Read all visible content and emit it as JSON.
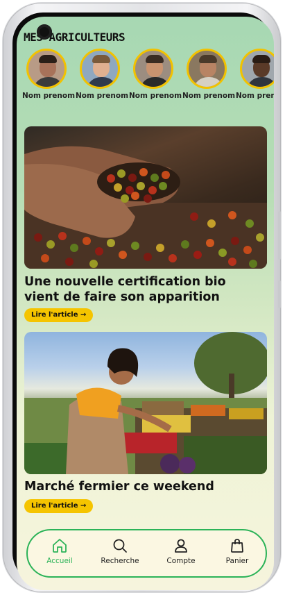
{
  "header": {
    "section_title": "MES AGRICULTEURS"
  },
  "farmers": [
    {
      "name": "Nom prenom"
    },
    {
      "name": "Nom prenom"
    },
    {
      "name": "Nom prenom"
    },
    {
      "name": "Nom prenom"
    },
    {
      "name": "Nom prenom"
    }
  ],
  "articles": [
    {
      "title": "Une nouvelle certification bio vient de faire son apparition",
      "button": "Lire l'article →"
    },
    {
      "title": "Marché fermier ce weekend",
      "button": "Lire l'article →"
    }
  ],
  "nav": {
    "items": [
      {
        "label": "Accueil",
        "icon": "home-icon",
        "active": true
      },
      {
        "label": "Recherche",
        "icon": "search-icon",
        "active": false
      },
      {
        "label": "Compte",
        "icon": "user-icon",
        "active": false
      },
      {
        "label": "Panier",
        "icon": "bag-icon",
        "active": false
      }
    ]
  },
  "colors": {
    "accent_green": "#2bb358",
    "button_yellow": "#f5c400",
    "avatar_ring": "#f2c200"
  }
}
